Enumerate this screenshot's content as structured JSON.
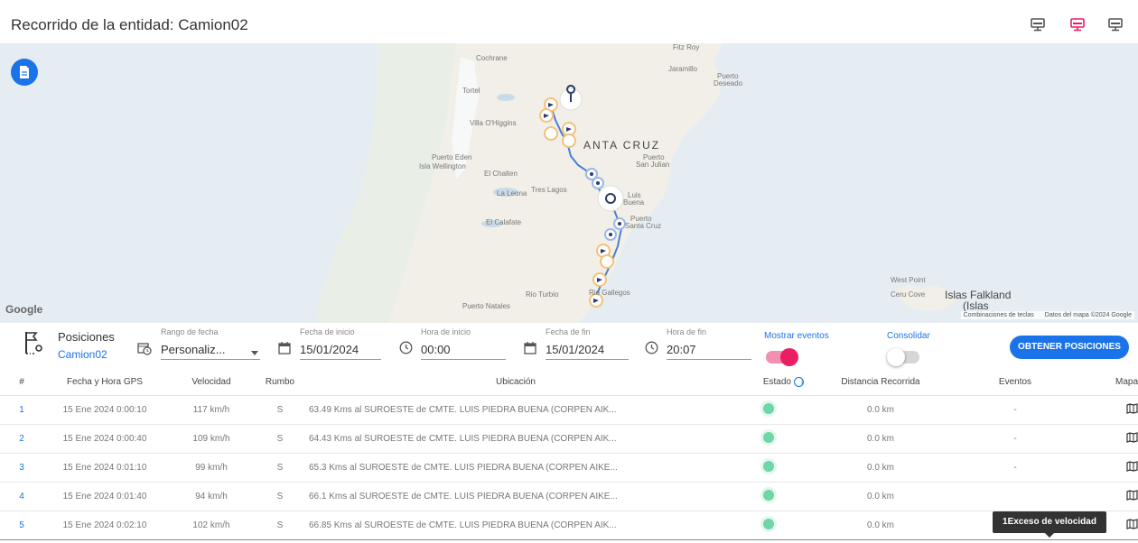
{
  "header": {
    "title": "Recorrido de la entidad: Camion02",
    "view_buttons": [
      {
        "icon": "monitor-icon",
        "color": "#555555"
      },
      {
        "icon": "monitor-icon",
        "color": "#e91e63"
      },
      {
        "icon": "monitor-icon",
        "color": "#555555"
      }
    ]
  },
  "map": {
    "report_icon": "document-icon",
    "labels": {
      "cochrane": "Cochrane",
      "fitzroy": "Fitz Roy",
      "jaramillo": "Jaramillo",
      "puerto_deseado_1": "Puerto",
      "puerto_deseado_2": "Deseado",
      "tortel": "Tortel",
      "villa_ohiggins": "Villa O'Higgins",
      "santa_cruz": "ANTA CRUZ",
      "puerto_eden": "Puerto Eden",
      "isla_wellington": "Isla Wellington",
      "el_chalten": "El Chalten",
      "puerto_sanjulian_1": "Puerto",
      "puerto_sanjulian_2": "San Julian",
      "la_leona": "La Leona",
      "tres_lagos": "Tres Lagos",
      "luis_piedra_1": "Luis",
      "luis_piedra_2": "Buena",
      "puerto_santacruz_1": "Puerto",
      "puerto_santacruz_2": "Santa Cruz",
      "el_calafate": "El Calafate",
      "west_point": "West Point",
      "ceru_cove": "Ceru Cove",
      "islas_falkland": "Islas Falkland",
      "islas": "(Islas",
      "rio_turbio": "Rio Turbio",
      "rio_gallegos": "Rio Gallegos",
      "puerto_natales": "Puerto Natales"
    },
    "google_logo": "Google",
    "footer_shortcuts": "Combinaciones de teclas",
    "footer_data": "Datos del mapa ©2024 Google"
  },
  "filters": {
    "section_icon": "route-flag-icon",
    "positions_title": "Posiciones",
    "entity": "Camion02",
    "date_range": {
      "label": "Rango de fecha",
      "value": "Personaliz..."
    },
    "start_date": {
      "label": "Fecha de inicio",
      "value": "15/01/2024"
    },
    "start_time": {
      "label": "Hora de inicio",
      "value": "00:00"
    },
    "end_date": {
      "label": "Fecha de fin",
      "value": "15/01/2024"
    },
    "end_time": {
      "label": "Hora de fin",
      "value": "20:07"
    },
    "show_events": {
      "label": "Mostrar eventos",
      "on": true
    },
    "consolidate": {
      "label": "Consolidar",
      "on": false
    },
    "get_button": "OBTENER POSICIONES"
  },
  "table": {
    "headers": {
      "index": "#",
      "datetime": "Fecha y Hora GPS",
      "speed": "Velocidad",
      "heading": "Rumbo",
      "location": "Ubicación",
      "status": "Estado",
      "distance": "Distancia Recorrida",
      "events": "Eventos",
      "map": "Mapa"
    },
    "rows": [
      {
        "index": "1",
        "datetime": "15 Ene 2024 0:00:10",
        "speed": "117 km/h",
        "heading": "S",
        "location": "63.49 Kms al SUROESTE de CMTE. LUIS PIEDRA BUENA (CORPEN AIK...",
        "distance": "0.0 km",
        "events": "-"
      },
      {
        "index": "2",
        "datetime": "15 Ene 2024 0:00:40",
        "speed": "109 km/h",
        "heading": "S",
        "location": "64.43 Kms al SUROESTE de CMTE. LUIS PIEDRA BUENA (CORPEN AIK...",
        "distance": "0.0 km",
        "events": "-"
      },
      {
        "index": "3",
        "datetime": "15 Ene 2024 0:01:10",
        "speed": "99 km/h",
        "heading": "S",
        "location": "65.3 Kms al SUROESTE de CMTE. LUIS PIEDRA BUENA (CORPEN AIKE...",
        "distance": "0.0 km",
        "events": "-"
      },
      {
        "index": "4",
        "datetime": "15 Ene 2024 0:01:40",
        "speed": "94 km/h",
        "heading": "S",
        "location": "66.1 Kms al SUROESTE de CMTE. LUIS PIEDRA BUENA (CORPEN AIKE...",
        "distance": "0.0 km",
        "events": ""
      },
      {
        "index": "5",
        "datetime": "15 Ene 2024 0:02:10",
        "speed": "102 km/h",
        "heading": "S",
        "location": "66.85 Kms al SUROESTE de CMTE. LUIS PIEDRA BUENA (CORPEN AIK...",
        "distance": "0.0 km",
        "events": "speedometer-icon"
      }
    ],
    "tooltip": "1Exceso de velocidad"
  },
  "colors": {
    "accent": "#1a73e8",
    "pink": "#e91e63",
    "status_ok": "#6fd6a7"
  }
}
